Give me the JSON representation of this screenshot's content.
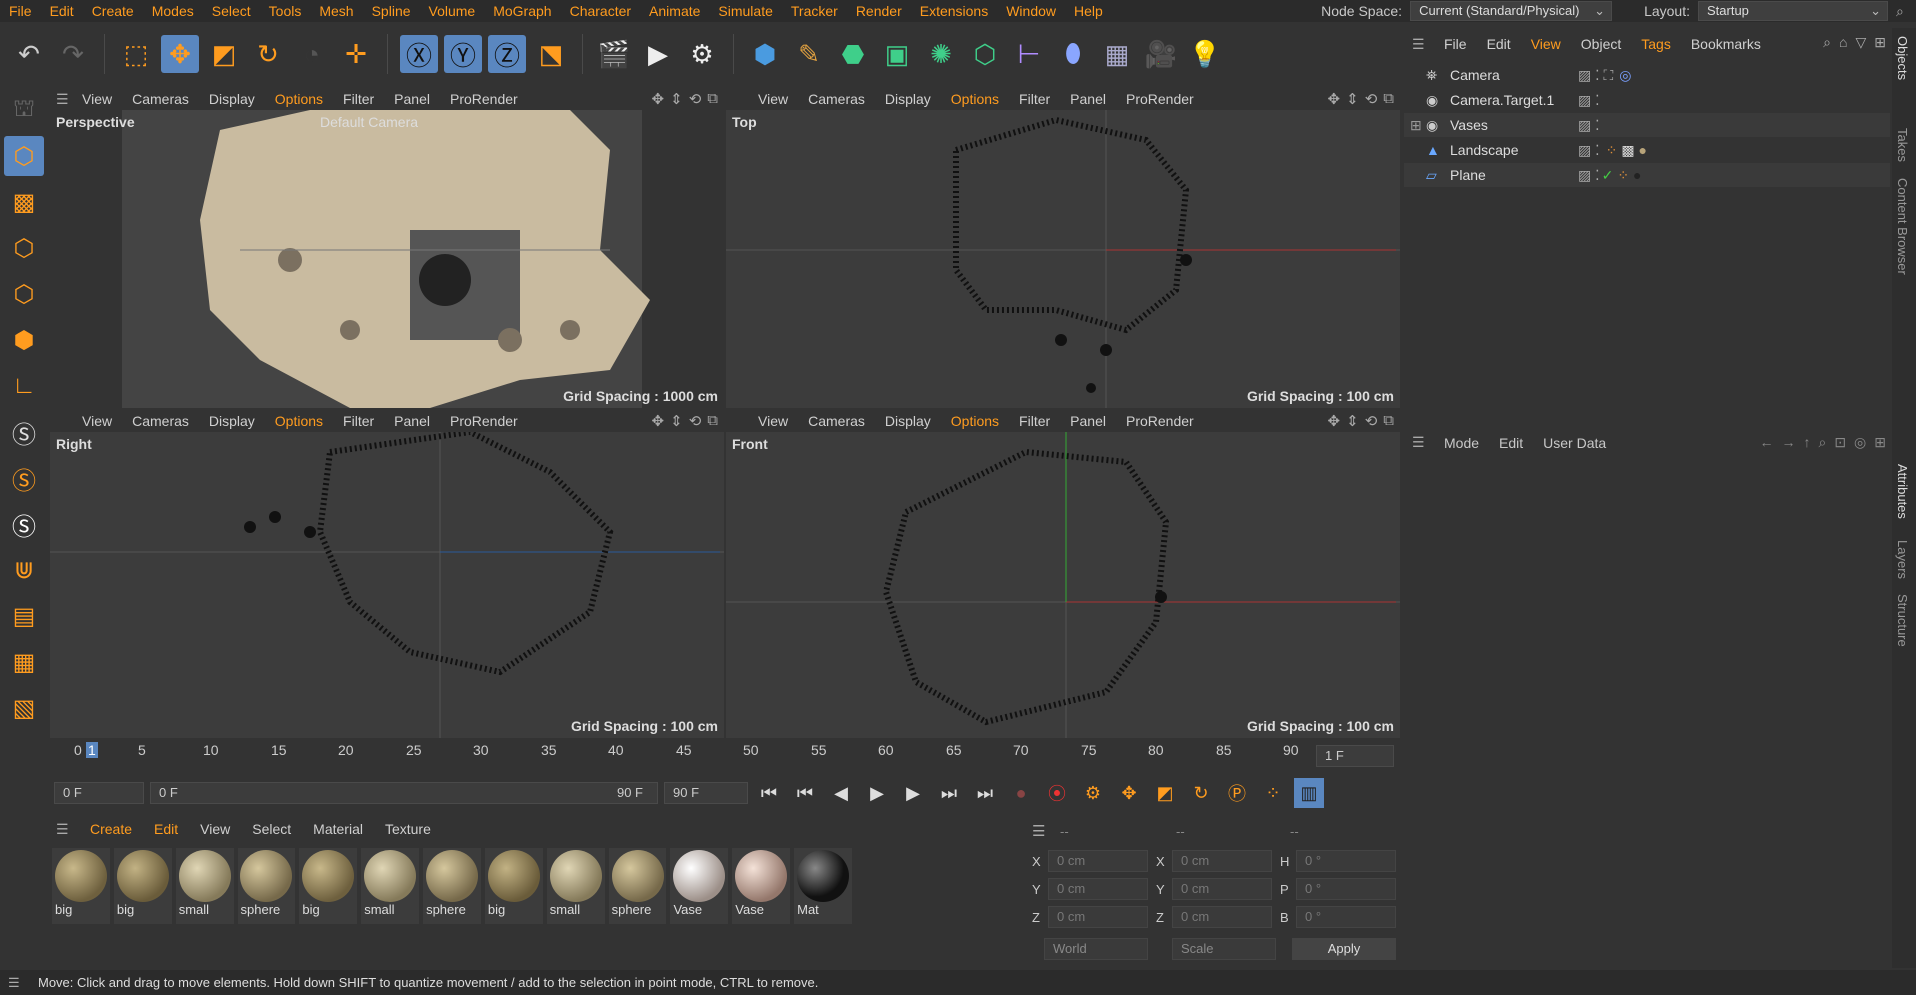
{
  "menubar": {
    "items": [
      "File",
      "Edit",
      "Create",
      "Modes",
      "Select",
      "Tools",
      "Mesh",
      "Spline",
      "Volume",
      "MoGraph",
      "Character",
      "Animate",
      "Simulate",
      "Tracker",
      "Render",
      "Extensions",
      "Window",
      "Help"
    ],
    "node_space_label": "Node Space:",
    "node_space_value": "Current (Standard/Physical)",
    "layout_label": "Layout:",
    "layout_value": "Startup"
  },
  "viewport_menu": [
    "View",
    "Cameras",
    "Display",
    "Options",
    "Filter",
    "Panel",
    "ProRender"
  ],
  "viewports": [
    {
      "name": "Perspective",
      "camera": "Default Camera",
      "grid": "Grid Spacing : 1000 cm"
    },
    {
      "name": "Top",
      "grid": "Grid Spacing : 100 cm"
    },
    {
      "name": "Right",
      "grid": "Grid Spacing : 100 cm"
    },
    {
      "name": "Front",
      "grid": "Grid Spacing : 100 cm"
    }
  ],
  "timeline": {
    "ticks": [
      "0",
      "1",
      "5",
      "10",
      "15",
      "20",
      "25",
      "30",
      "35",
      "40",
      "45",
      "50",
      "55",
      "60",
      "65",
      "70",
      "75",
      "80",
      "85",
      "90"
    ],
    "current_frame": "1 F",
    "start": "0 F",
    "range_start": "0 F",
    "range_end": "90 F",
    "end": "90 F"
  },
  "material_menu": [
    "Create",
    "Edit",
    "View",
    "Select",
    "Material",
    "Texture"
  ],
  "materials": [
    {
      "name": "big",
      "color": "#8a7a55"
    },
    {
      "name": "big",
      "color": "#85764f"
    },
    {
      "name": "small",
      "color": "#b0a582"
    },
    {
      "name": "sphere",
      "color": "#9d8f66"
    },
    {
      "name": "big",
      "color": "#8a7a55"
    },
    {
      "name": "small",
      "color": "#b0a582"
    },
    {
      "name": "sphere",
      "color": "#9d8f66"
    },
    {
      "name": "big",
      "color": "#85764f"
    },
    {
      "name": "small",
      "color": "#b0a582"
    },
    {
      "name": "sphere",
      "color": "#9d8f66"
    },
    {
      "name": "Vase",
      "color": "#d8c9c0"
    },
    {
      "name": "Vase",
      "color": "#cdb3a8"
    },
    {
      "name": "Mat",
      "color": "#1a1a1a"
    }
  ],
  "coords": {
    "headers": [
      "--",
      "--",
      "--"
    ],
    "rows": [
      {
        "a": "X",
        "av": "0 cm",
        "b": "X",
        "bv": "0 cm",
        "c": "H",
        "cv": "0 °"
      },
      {
        "a": "Y",
        "av": "0 cm",
        "b": "Y",
        "bv": "0 cm",
        "c": "P",
        "cv": "0 °"
      },
      {
        "a": "Z",
        "av": "0 cm",
        "b": "Z",
        "bv": "0 cm",
        "c": "B",
        "cv": "0 °"
      }
    ],
    "mode": "World",
    "scale": "Scale",
    "apply": "Apply"
  },
  "object_menu": [
    "File",
    "Edit",
    "View",
    "Object",
    "Tags",
    "Bookmarks"
  ],
  "objects": [
    {
      "name": "Camera",
      "icon": "camera-icon"
    },
    {
      "name": "Camera.Target.1",
      "icon": "null-icon"
    },
    {
      "name": "Vases",
      "icon": "null-icon"
    },
    {
      "name": "Landscape",
      "icon": "landscape-icon"
    },
    {
      "name": "Plane",
      "icon": "plane-icon"
    }
  ],
  "attr_menu": [
    "Mode",
    "Edit",
    "User Data"
  ],
  "side_tabs": [
    "Objects",
    "Takes",
    "Content Browser",
    "Attributes",
    "Layers",
    "Structure"
  ],
  "status": "Move: Click and drag to move elements. Hold down SHIFT to quantize movement / add to the selection in point mode, CTRL to remove."
}
